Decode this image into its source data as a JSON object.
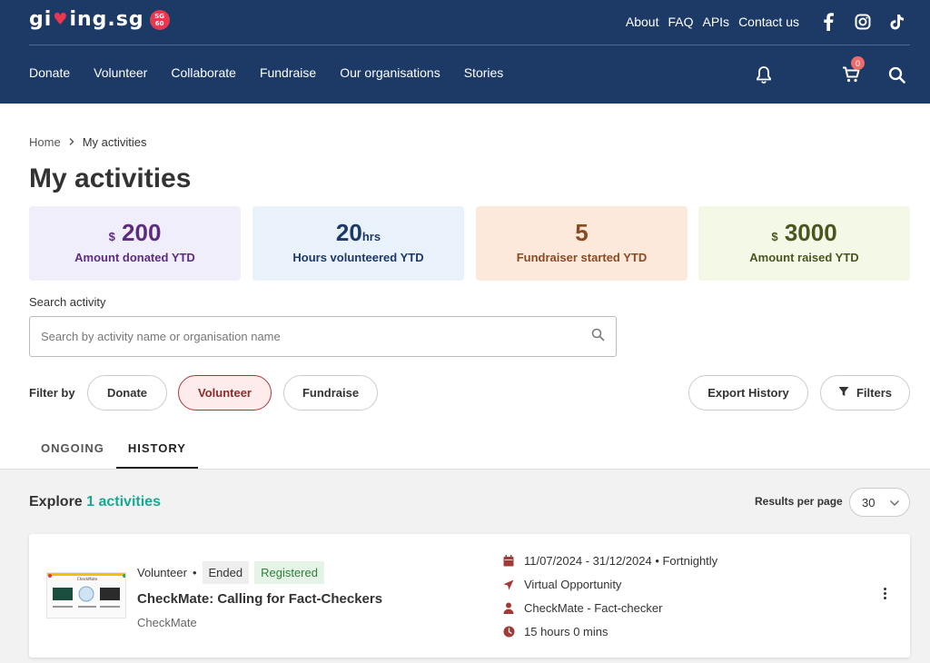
{
  "header": {
    "logo_text_1": "gi",
    "logo_heart": "♥",
    "logo_text_2": "ing.sg",
    "logo_badge_top": "SG",
    "logo_badge_bottom": "60",
    "top_links": [
      "About",
      "FAQ",
      "APIs",
      "Contact us"
    ],
    "social_icons": [
      "facebook-icon",
      "instagram-icon",
      "tiktok-icon"
    ],
    "nav": [
      "Donate",
      "Volunteer",
      "Collaborate",
      "Fundraise",
      "Our organisations",
      "Stories"
    ],
    "cart_count": "0",
    "brand_color": "#1d3a66"
  },
  "breadcrumb": {
    "home": "Home",
    "current": "My activities"
  },
  "page_title": "My activities",
  "stats": [
    {
      "prefix": "$",
      "value": "200",
      "suffix": "",
      "label": "Amount donated YTD",
      "bg": "#f1eefc",
      "color": "#5c2d7f"
    },
    {
      "prefix": "",
      "value": "20",
      "suffix": "hrs",
      "label": "Hours volunteered YTD",
      "bg": "#e9f1fb",
      "color": "#1d3a66"
    },
    {
      "prefix": "",
      "value": "5",
      "suffix": "",
      "label": "Fundraiser started YTD",
      "bg": "#fde9dc",
      "color": "#8a4a20"
    },
    {
      "prefix": "$",
      "value": "3000",
      "suffix": "",
      "label": "Amount raised YTD",
      "bg": "#f4f8e6",
      "color": "#4a5520"
    }
  ],
  "search": {
    "label": "Search activity",
    "placeholder": "Search by activity name or organisation name",
    "value": ""
  },
  "filter": {
    "label": "Filter by",
    "options": [
      "Donate",
      "Volunteer",
      "Fundraise"
    ],
    "active": "Volunteer",
    "export_label": "Export History",
    "filters_label": "Filters"
  },
  "tabs": {
    "ongoing": "ONGOING",
    "history": "HISTORY",
    "active": "HISTORY"
  },
  "results": {
    "explore_prefix": "Explore",
    "explore_count": "1 activities",
    "per_page_label": "Results per page",
    "per_page_value": "30"
  },
  "activity": {
    "type": "Volunteer",
    "status": "Ended",
    "registration": "Registered",
    "title": "CheckMate: Calling for Fact-Checkers",
    "org": "CheckMate",
    "thumb_caption": "CheckMate",
    "dates": "11/07/2024 - 31/12/2024 • Fortnightly",
    "location": "Virtual Opportunity",
    "role": "CheckMate - Fact-checker",
    "hours": "15 hours 0 mins"
  }
}
